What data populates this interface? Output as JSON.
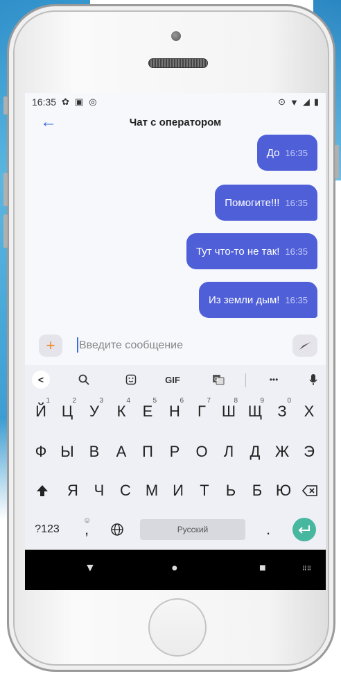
{
  "status_bar": {
    "time": "16:35",
    "left_icons": [
      "gear-icon",
      "gallery-icon",
      "vpn-icon"
    ],
    "right_icons": [
      "location-icon",
      "wifi-icon",
      "signal-icon",
      "battery-icon"
    ]
  },
  "app_bar": {
    "title": "Чат с оператором",
    "back_icon": "back-arrow-icon"
  },
  "messages": [
    {
      "text": "До",
      "time": "16:35"
    },
    {
      "text": "Помогите!!!",
      "time": "16:35"
    },
    {
      "text": "Тут что-то не так!",
      "time": "16:35"
    },
    {
      "text": "Из земли дым!",
      "time": "16:35"
    }
  ],
  "composer": {
    "placeholder": "Введите сообщение",
    "plus_label": "+",
    "send_icon": "send-icon",
    "accent_color": "#f08a2a"
  },
  "keyboard": {
    "toolbar": [
      "<",
      "search-icon",
      "sticker-icon",
      "GIF",
      "translate-icon",
      "•••",
      "mic-icon"
    ],
    "gif_label": "GIF",
    "more_label": "•••",
    "row1": [
      "Й",
      "Ц",
      "У",
      "К",
      "Е",
      "Н",
      "Г",
      "Ш",
      "Щ",
      "З",
      "Х"
    ],
    "row1_sup": [
      "1",
      "2",
      "3",
      "4",
      "5",
      "6",
      "7",
      "8",
      "9",
      "0",
      ""
    ],
    "row2": [
      "Ф",
      "Ы",
      "В",
      "А",
      "П",
      "Р",
      "О",
      "Л",
      "Д",
      "Ж",
      "Э"
    ],
    "row3": [
      "Я",
      "Ч",
      "С",
      "М",
      "И",
      "Т",
      "Ь",
      "Б",
      "Ю"
    ],
    "num_label": "?123",
    "comma_label": ",",
    "space_label": "Русский",
    "period_label": ".",
    "enter_color": "#47b7a0"
  },
  "colors": {
    "bubble": "#4f5fd8",
    "accent_blue": "#3a6ed8"
  }
}
